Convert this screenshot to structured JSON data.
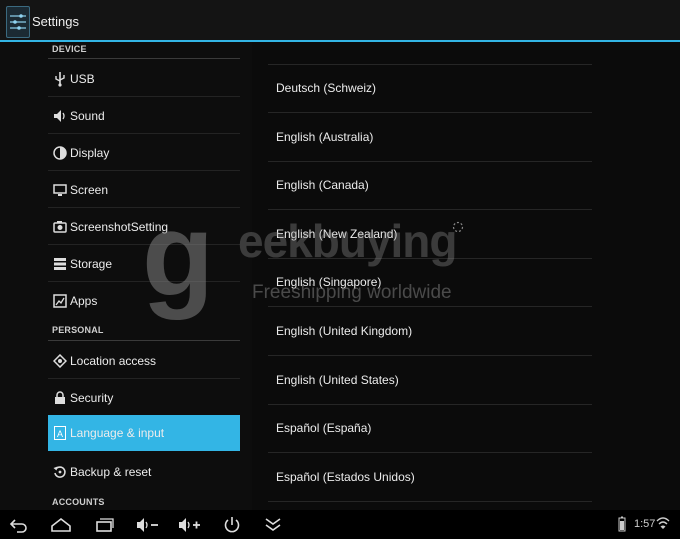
{
  "action_bar": {
    "title": "Settings",
    "accent": "#33b5e5"
  },
  "sidebar": {
    "device_header": "DEVICE",
    "personal_header": "PERSONAL",
    "accounts_header": "ACCOUNTS",
    "device_items": [
      {
        "label": "USB",
        "icon": "usb-icon"
      },
      {
        "label": "Sound",
        "icon": "sound-icon"
      },
      {
        "label": "Display",
        "icon": "display-icon"
      },
      {
        "label": "Screen",
        "icon": "screen-icon"
      },
      {
        "label": "ScreenshotSetting",
        "icon": "screenshot-icon"
      },
      {
        "label": "Storage",
        "icon": "storage-icon"
      },
      {
        "label": "Apps",
        "icon": "apps-icon"
      }
    ],
    "personal_items": [
      {
        "label": "Location access",
        "icon": "location-icon"
      },
      {
        "label": "Security",
        "icon": "lock-icon"
      },
      {
        "label": "Language & input",
        "icon": "language-icon",
        "selected": true
      },
      {
        "label": "Backup & reset",
        "icon": "backup-icon"
      }
    ]
  },
  "languages": [
    "Deutsch (Schweiz)",
    "English (Australia)",
    "English (Canada)",
    "English (New Zealand)",
    "English (Singapore)",
    "English (United Kingdom)",
    "English (United States)",
    "Español (España)",
    "Español (Estados Unidos)"
  ],
  "watermark": {
    "logo_letter": "g",
    "brand": "eekbuying",
    "tagline": "Freeshipping worldwide"
  },
  "system_bar": {
    "clock": "1:57",
    "buttons": [
      "back-icon",
      "home-icon",
      "recent-apps-icon",
      "volume-down-icon",
      "volume-up-icon",
      "power-icon",
      "collapse-icon"
    ]
  }
}
